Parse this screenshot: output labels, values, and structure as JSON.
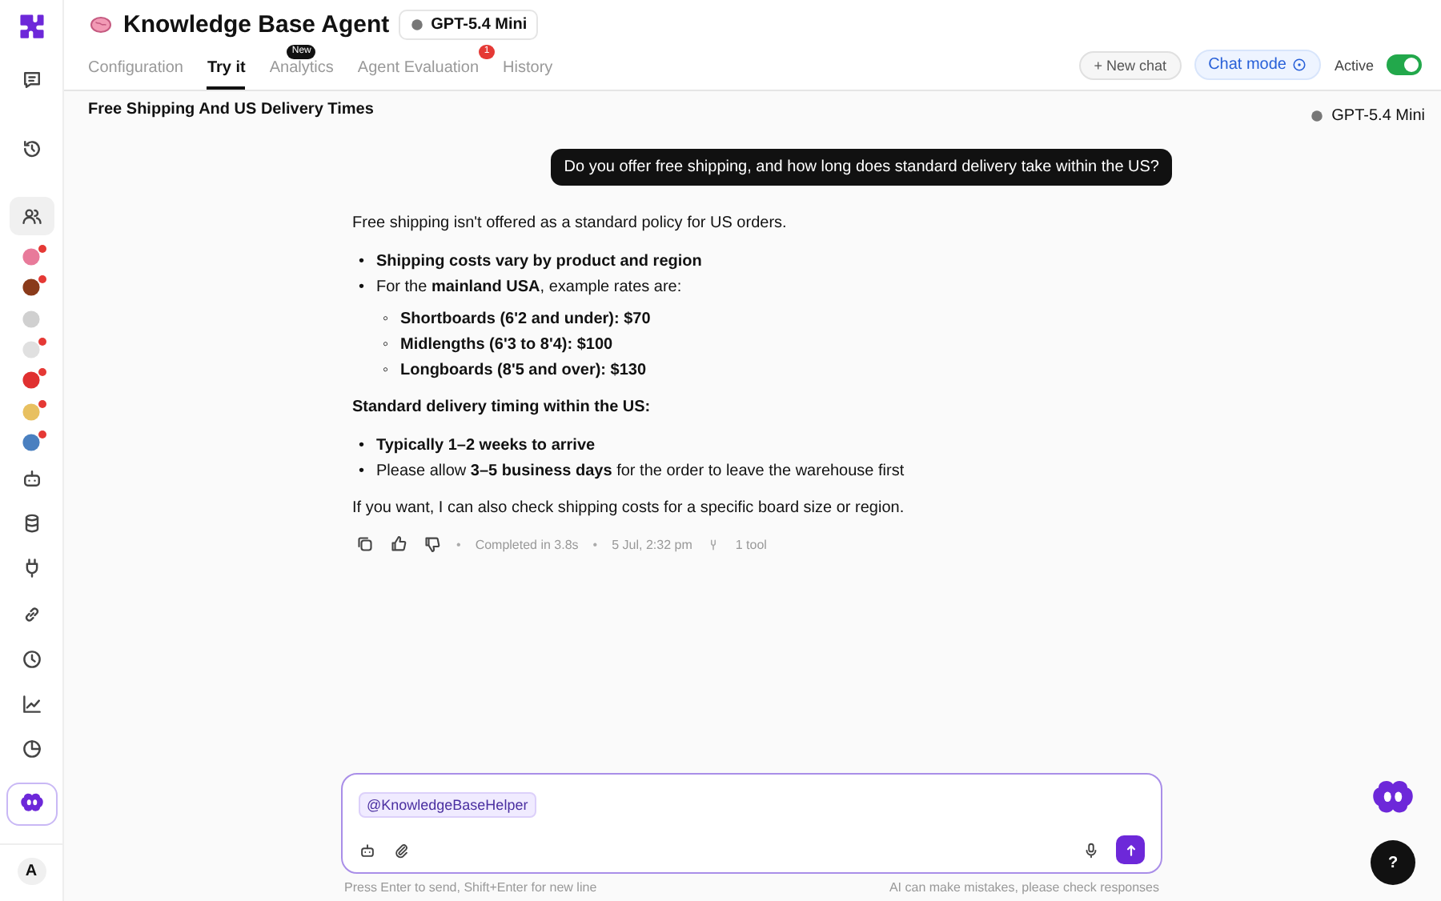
{
  "sidebar": {
    "items": [
      {
        "kind": "chat",
        "selected": false,
        "alert": false
      },
      {
        "kind": "history",
        "selected": false,
        "alert": false
      },
      {
        "kind": "people",
        "selected": true,
        "alert": false
      },
      {
        "kind": "avatar",
        "color": "#e87a9a",
        "selected": false,
        "alert": true
      },
      {
        "kind": "avatar",
        "color": "#8a3a1a",
        "selected": false,
        "alert": true
      },
      {
        "kind": "avatar",
        "color": "#d0d0d0",
        "selected": false,
        "alert": false
      },
      {
        "kind": "avatar",
        "color": "#e0e0e0",
        "selected": false,
        "alert": true
      },
      {
        "kind": "avatar",
        "color": "#e03030",
        "selected": false,
        "alert": true
      },
      {
        "kind": "avatar",
        "color": "#e8c060",
        "selected": false,
        "alert": true
      },
      {
        "kind": "avatar",
        "color": "#4a80c0",
        "selected": false,
        "alert": true
      },
      {
        "kind": "robot",
        "selected": false,
        "alert": false
      },
      {
        "kind": "database",
        "selected": false,
        "alert": false
      },
      {
        "kind": "plug",
        "selected": false,
        "alert": false
      },
      {
        "kind": "link",
        "selected": false,
        "alert": false
      },
      {
        "kind": "clock",
        "selected": false,
        "alert": false
      },
      {
        "kind": "chart",
        "selected": false,
        "alert": false
      },
      {
        "kind": "pie",
        "selected": false,
        "alert": false
      },
      {
        "kind": "brand",
        "selected": false,
        "alert": false
      }
    ],
    "user_initial": "A"
  },
  "header": {
    "title": "Knowledge Base Agent",
    "model": "GPT-5.4 Mini"
  },
  "tabs": [
    {
      "label": "Configuration",
      "selected": false
    },
    {
      "label": "Try it",
      "selected": true
    },
    {
      "label": "Analytics",
      "selected": false,
      "badge": {
        "text": "New",
        "color": "#111111"
      }
    },
    {
      "label": "Agent Evaluation",
      "selected": false,
      "badge": {
        "text": "1",
        "color": "#e53935"
      }
    },
    {
      "label": "History",
      "selected": false
    }
  ],
  "actions": {
    "new_chat": "+ New chat",
    "chat_mode": "Chat mode",
    "active_label": "Active",
    "active": true
  },
  "conversation": {
    "title": "Free Shipping And US Delivery Times",
    "model": "GPT-5.4 Mini"
  },
  "user_message": "Do you offer free shipping, and how long does standard delivery take within the US?",
  "answer": [
    {
      "kind": "paragraph",
      "text": "Free shipping isn't offered as a standard policy for US orders."
    },
    {
      "kind": "list",
      "marker": "•",
      "child_marker": "◦",
      "items": [
        {
          "text": "**Shipping costs vary by product and region**"
        },
        {
          "text": "For the **mainland USA**, example rates are:",
          "children": [
            {
              "text": "**Shortboards (6'2 and under): $70**"
            },
            {
              "text": "**Midlengths (6'3 to 8'4): $100**"
            },
            {
              "text": "**Longboards (8'5 and over): $130**"
            }
          ]
        }
      ]
    },
    {
      "kind": "heading",
      "text": "Standard delivery timing within the US:"
    },
    {
      "kind": "list",
      "marker": "•",
      "items": [
        {
          "text": "**Typically 1–2 weeks to arrive**"
        },
        {
          "text": "Please allow **3–5 business days** for the order to leave the warehouse first"
        }
      ]
    },
    {
      "kind": "paragraph",
      "text": "If you want, I can also check shipping costs for a specific board size or region."
    }
  ],
  "meta": {
    "separator": "•",
    "status": "Completed in 3.8s",
    "time": "5 Jul, 2:32 pm",
    "tools": "1 tool"
  },
  "composer": {
    "mention": "@KnowledgeBaseHelper",
    "hint": "Press Enter to send, Shift+Enter for new line",
    "disclaimer": "AI can make mistakes, please check responses"
  },
  "help_button": "?"
}
